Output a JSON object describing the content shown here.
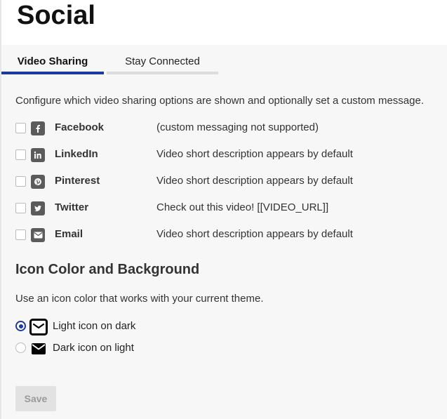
{
  "page": {
    "title": "Social"
  },
  "tabs": [
    {
      "label": "Video Sharing",
      "active": true
    },
    {
      "label": "Stay Connected",
      "active": false
    }
  ],
  "intro": "Configure which video sharing options are shown and optionally set a custom message.",
  "share_options": [
    {
      "name": "Facebook",
      "icon": "facebook-icon",
      "message": "(custom messaging not supported)",
      "checked": false
    },
    {
      "name": "LinkedIn",
      "icon": "linkedin-icon",
      "message": "Video short description appears by default",
      "checked": false
    },
    {
      "name": "Pinterest",
      "icon": "pinterest-icon",
      "message": "Video short description appears by default",
      "checked": false
    },
    {
      "name": "Twitter",
      "icon": "twitter-icon",
      "message": "Check out this video! [[VIDEO_URL]]",
      "checked": false
    },
    {
      "name": "Email",
      "icon": "email-icon",
      "message": "Video short description appears by default",
      "checked": false
    }
  ],
  "icon_color": {
    "title": "Icon Color and Background",
    "description": "Use an icon color that works with your current theme.",
    "options": [
      {
        "label": "Light icon on dark",
        "selected": true,
        "icon": "envelope-outline-icon"
      },
      {
        "label": "Dark icon on light",
        "selected": false,
        "icon": "envelope-filled-icon"
      }
    ]
  },
  "save_label": "Save",
  "colors": {
    "accent": "#1a3aa0",
    "icon_bg": "#5b5b5b",
    "content_bg": "#f7f7f7",
    "button_bg": "#e2e2e2"
  }
}
